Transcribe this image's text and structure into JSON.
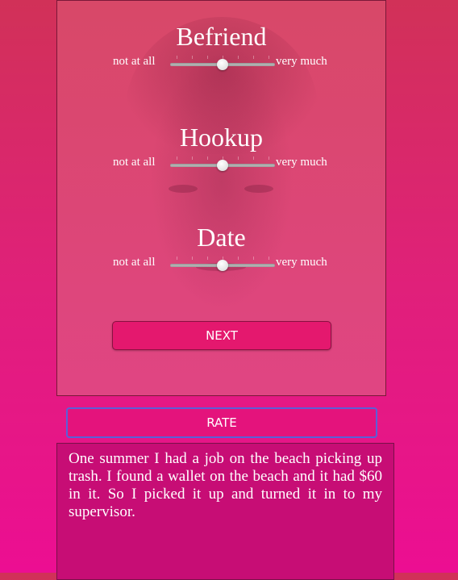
{
  "ratings": [
    {
      "title": "Befriend",
      "low_label": "not at all",
      "high_label": "very much",
      "value": 0.5
    },
    {
      "title": "Hookup",
      "low_label": "not at all",
      "high_label": "very much",
      "value": 0.5
    },
    {
      "title": "Date",
      "low_label": "not at all",
      "high_label": "very much",
      "value": 0.5
    }
  ],
  "next_label": "NEXT",
  "rate_label": "RATE",
  "story_text": "One summer I had a job on the beach picking up trash. I found a wallet on the beach and it had $60 in it. So I picked it up and turned it in to my supervisor."
}
